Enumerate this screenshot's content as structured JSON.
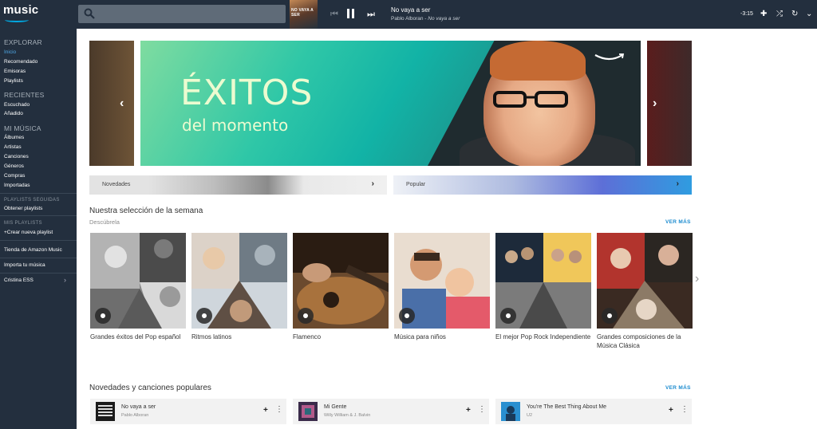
{
  "header": {
    "logo_text": "music",
    "now_playing": {
      "art_text": "NO VAYA A SER",
      "title": "No vaya a ser",
      "artist": "Pablo Alboran",
      "separator": "-",
      "album": "No vaya a ser"
    },
    "time_remaining": "-3:15"
  },
  "sidebar": {
    "explorar": {
      "title": "EXPLORAR",
      "items": [
        "Inicio",
        "Recomendado",
        "Emisoras",
        "Playlists"
      ],
      "active": "Inicio"
    },
    "recientes": {
      "title": "RECIENTES",
      "items": [
        "Escuchado",
        "Añadido"
      ]
    },
    "mi_musica": {
      "title": "MI MÚSICA",
      "items": [
        "Álbumes",
        "Artistas",
        "Canciones",
        "Géneros",
        "Compras",
        "Importadas"
      ]
    },
    "playlists_seguidas": {
      "title": "PLAYLISTS SEGUIDAS",
      "items": [
        "Obtener playlists"
      ]
    },
    "mis_playlists": {
      "title": "MIS PLAYLISTS",
      "items": [
        "+Crear nueva playlist"
      ]
    },
    "tienda": "Tienda de Amazon Music",
    "importa": "Importa tu música",
    "user": "Cristina ESS",
    "user_chevron": "›"
  },
  "hero": {
    "big_text": "ÉXITOS",
    "small_text": "del momento"
  },
  "category_bars": [
    {
      "label": "Novedades",
      "chevron": "›"
    },
    {
      "label": "Popular",
      "chevron": "›"
    }
  ],
  "selection": {
    "title": "Nuestra selección de la semana",
    "subtitle": "Descúbrela",
    "ver_mas": "VER MÁS",
    "cards": [
      {
        "label": "Grandes éxitos del Pop español"
      },
      {
        "label": "Ritmos latinos"
      },
      {
        "label": "Flamenco"
      },
      {
        "label": "Música para niños"
      },
      {
        "label": "El mejor Pop Rock Independiente"
      },
      {
        "label": "Grandes composiciones de la Música Clásica"
      }
    ]
  },
  "popular": {
    "title": "Novedades y canciones populares",
    "ver_mas": "VER MÁS",
    "songs": [
      {
        "title": "No vaya a ser",
        "artist": "Pablo Alboran"
      },
      {
        "title": "Mi Gente",
        "artist": "Willy William & J. Balvin"
      },
      {
        "title": "You're The Best Thing About Me",
        "artist": "U2"
      }
    ]
  },
  "colors": {
    "nav_bg": "#232f3e",
    "accent": "#00a8e1",
    "active_link": "#4fa8e6",
    "ver_mas": "#1b8bcf"
  }
}
